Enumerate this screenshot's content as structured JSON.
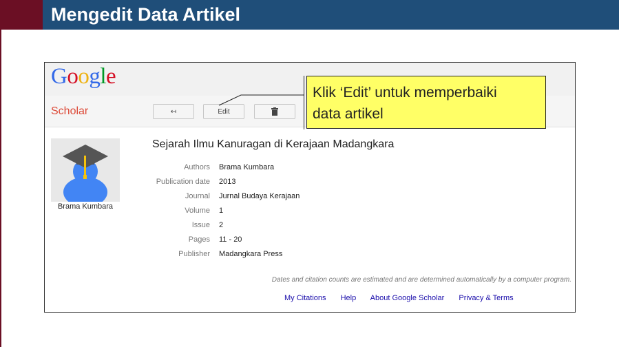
{
  "slide": {
    "title": "Mengedit Data Artikel"
  },
  "google": {
    "logo_letters": [
      "G",
      "o",
      "o",
      "g",
      "l",
      "e"
    ],
    "logo_colors": [
      "#3369e8",
      "#d50f25",
      "#eeb211",
      "#3369e8",
      "#009925",
      "#d50f25"
    ],
    "scholar_label": "Scholar"
  },
  "toolbar": {
    "back_icon": "↤",
    "edit_label": "Edit",
    "delete_icon": "🗑"
  },
  "profile": {
    "name": "Brama Kumbara"
  },
  "article": {
    "title": "Sejarah Ilmu Kanuragan di Kerajaan Madangkara",
    "fields": [
      {
        "label": "Authors",
        "value": "Brama Kumbara"
      },
      {
        "label": "Publication date",
        "value": "2013"
      },
      {
        "label": "Journal",
        "value": "Jurnal Budaya Kerajaan"
      },
      {
        "label": "Volume",
        "value": "1"
      },
      {
        "label": "Issue",
        "value": "2"
      },
      {
        "label": "Pages",
        "value": "11 - 20"
      },
      {
        "label": "Publisher",
        "value": "Madangkara Press"
      }
    ]
  },
  "note": "Dates and citation counts are estimated and are determined automatically by a computer program.",
  "footer": {
    "links": [
      "My Citations",
      "Help",
      "About Google Scholar",
      "Privacy & Terms"
    ]
  },
  "callout": {
    "line1": "Klik ‘Edit’ untuk memperbaiki",
    "line2": "data artikel"
  },
  "colors": {
    "title_bar": "#1f4e79",
    "accent": "#6b0f24",
    "callout_bg": "#ffff66",
    "scholar_red": "#dd4b39",
    "link_blue": "#1a0dab"
  }
}
